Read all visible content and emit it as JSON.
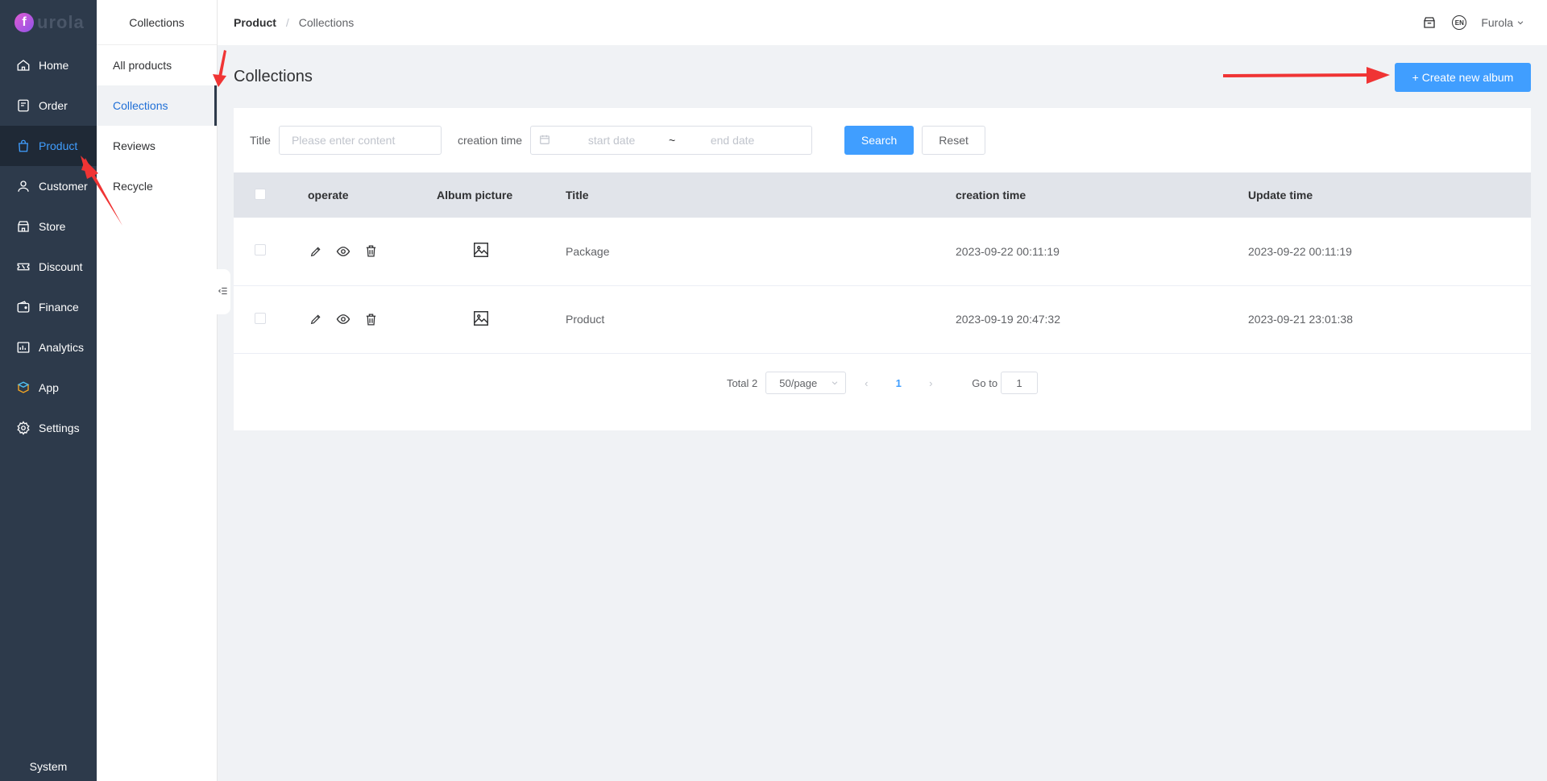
{
  "app": {
    "logo_letter": "f",
    "logo_text": "urola"
  },
  "sidebar": {
    "items": [
      {
        "label": "Home",
        "icon": "home-icon"
      },
      {
        "label": "Order",
        "icon": "order-icon"
      },
      {
        "label": "Product",
        "icon": "bag-icon",
        "active": true
      },
      {
        "label": "Customer",
        "icon": "user-icon"
      },
      {
        "label": "Store",
        "icon": "store-icon"
      },
      {
        "label": "Discount",
        "icon": "ticket-icon"
      },
      {
        "label": "Finance",
        "icon": "wallet-icon"
      },
      {
        "label": "Analytics",
        "icon": "chart-icon"
      },
      {
        "label": "App",
        "icon": "cube-icon"
      },
      {
        "label": "Settings",
        "icon": "gear-icon"
      }
    ],
    "footer": "System"
  },
  "subnav": {
    "title": "Collections",
    "items": [
      {
        "label": "All products"
      },
      {
        "label": "Collections",
        "active": true
      },
      {
        "label": "Reviews"
      },
      {
        "label": "Recycle"
      }
    ]
  },
  "header": {
    "breadcrumb": [
      "Product",
      "Collections"
    ],
    "lang": "EN",
    "user": "Furola"
  },
  "main": {
    "title": "Collections",
    "create_label": "+ Create new album"
  },
  "filter": {
    "title_label": "Title",
    "title_placeholder": "Please enter content",
    "time_label": "creation time",
    "start_placeholder": "start date",
    "separator": "~",
    "end_placeholder": "end date",
    "search_label": "Search",
    "reset_label": "Reset"
  },
  "table": {
    "columns": [
      "operate",
      "Album picture",
      "Title",
      "creation time",
      "Update time"
    ],
    "rows": [
      {
        "title": "Package",
        "created": "2023-09-22 00:11:19",
        "updated": "2023-09-22 00:11:19"
      },
      {
        "title": "Product",
        "created": "2023-09-19 20:47:32",
        "updated": "2023-09-21 23:01:38"
      }
    ]
  },
  "pagination": {
    "total": "Total 2",
    "page_size": "50/page",
    "current": "1",
    "goto_label": "Go to",
    "goto_value": "1"
  },
  "colors": {
    "accent": "#409eff",
    "sidebar": "#2d3a4b",
    "annotation": "#f03434"
  }
}
